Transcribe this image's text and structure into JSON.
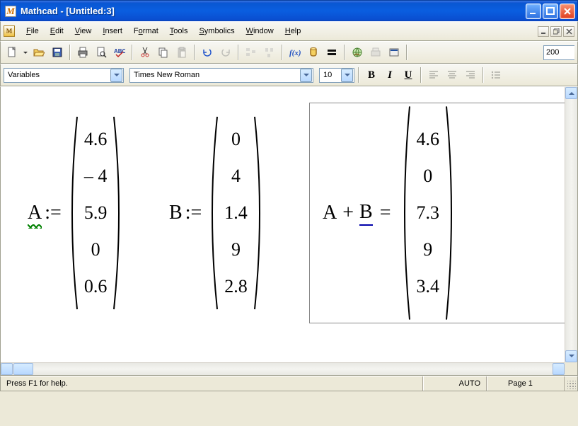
{
  "window": {
    "title": "Mathcad - [Untitled:3]"
  },
  "menu": {
    "file": "File",
    "edit": "Edit",
    "view": "View",
    "insert": "Insert",
    "format": "Format",
    "tools": "Tools",
    "symbolics": "Symbolics",
    "window": "Window",
    "help": "Help"
  },
  "zoom": "200",
  "format_bar": {
    "style": "Variables",
    "font": "Times New Roman",
    "size": "10",
    "bold": "B",
    "italic": "I",
    "underline": "U"
  },
  "math": {
    "A_name": "A",
    "assign": ":=",
    "A_vec": [
      "4.6",
      "– 4",
      "5.9",
      "0",
      "0.6"
    ],
    "B_name": "B",
    "B_vec": [
      "0",
      "4",
      "1.4",
      "9",
      "2.8"
    ],
    "expr_A": "A",
    "plus": "+",
    "expr_B": "B",
    "equals": "=",
    "result_vec": [
      "4.6",
      "0",
      "7.3",
      "9",
      "3.4"
    ]
  },
  "status": {
    "help": "Press F1 for help.",
    "auto": "AUTO",
    "page": "Page 1"
  }
}
